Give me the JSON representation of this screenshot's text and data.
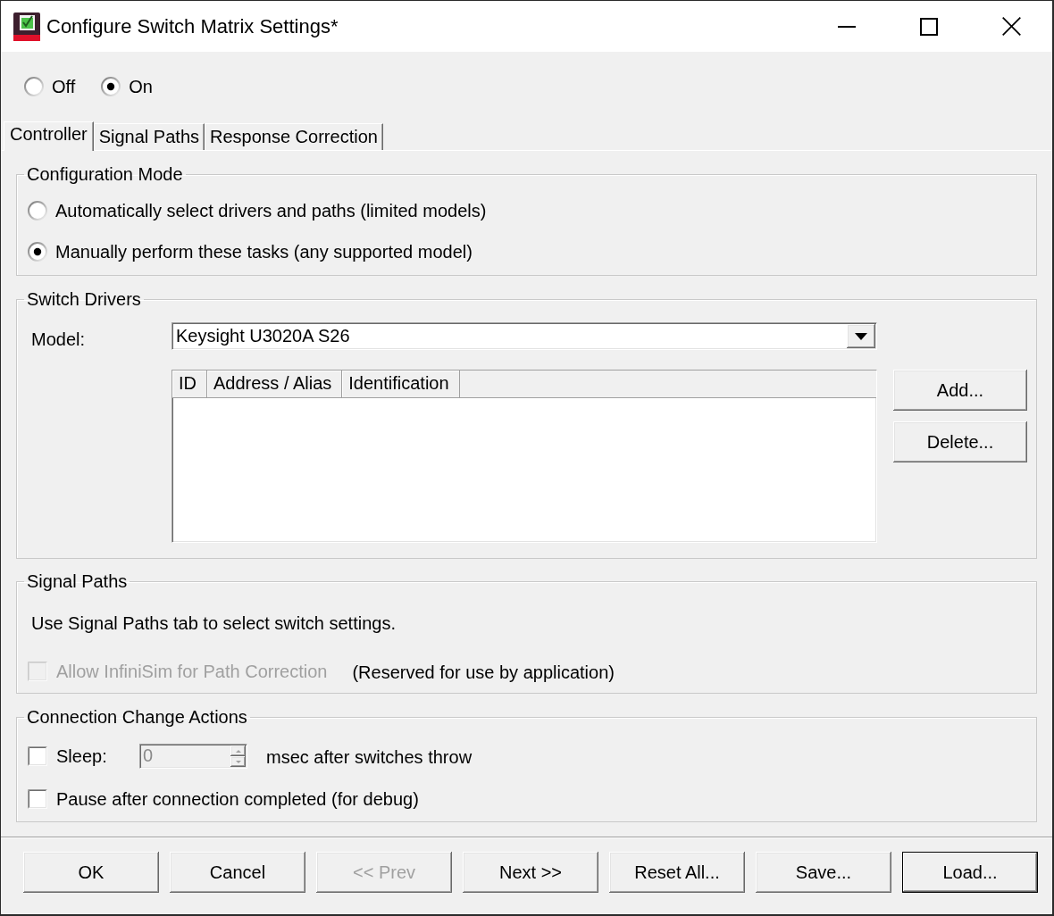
{
  "window": {
    "title": "Configure Switch Matrix Settings*"
  },
  "power": [
    {
      "label": "Off",
      "selected": false
    },
    {
      "label": "On",
      "selected": true
    }
  ],
  "tabs": [
    {
      "label": "Controller",
      "selected": true
    },
    {
      "label": "Signal Paths",
      "selected": false
    },
    {
      "label": "Response Correction",
      "selected": false
    }
  ],
  "configuration_mode": {
    "title": "Configuration Mode",
    "options": [
      {
        "label": "Automatically select drivers and paths (limited models)",
        "selected": false
      },
      {
        "label": "Manually perform these tasks (any supported model)",
        "selected": true
      }
    ]
  },
  "switch_drivers": {
    "title": "Switch Drivers",
    "model_label": "Model:",
    "model": {
      "value": "Keysight U3020A S26"
    },
    "table": {
      "columns": [
        "ID",
        "Address / Alias",
        "Identification"
      ]
    },
    "buttons": [
      {
        "label": "Add..."
      },
      {
        "label": "Delete..."
      }
    ]
  },
  "signal_paths": {
    "title": "Signal Paths",
    "note": "Use Signal Paths tab to select switch settings.",
    "allow_infinisim": {
      "label": "Allow InfiniSim for Path Correction",
      "checked": false,
      "disabled": true
    },
    "reserved_note": "(Reserved for use by application)"
  },
  "connection_change_actions": {
    "title": "Connection Change Actions",
    "sleep": {
      "label": "Sleep:",
      "checked": false,
      "disabled": false
    },
    "sleep_ms": {
      "value": "0",
      "disabled": true
    },
    "sleep_unit": "msec after switches throw",
    "pause": {
      "label": "Pause after connection completed (for debug)",
      "checked": false,
      "disabled": false
    }
  },
  "buttons": [
    {
      "label": "OK",
      "disabled": false,
      "default": false
    },
    {
      "label": "Cancel",
      "disabled": false,
      "default": false
    },
    {
      "label": "<< Prev",
      "disabled": true,
      "default": false
    },
    {
      "label": "Next >>",
      "disabled": false,
      "default": false
    },
    {
      "label": "Reset All...",
      "disabled": false,
      "default": false
    },
    {
      "label": "Save...",
      "disabled": false,
      "default": false
    },
    {
      "label": "Load...",
      "disabled": false,
      "default": true
    }
  ]
}
